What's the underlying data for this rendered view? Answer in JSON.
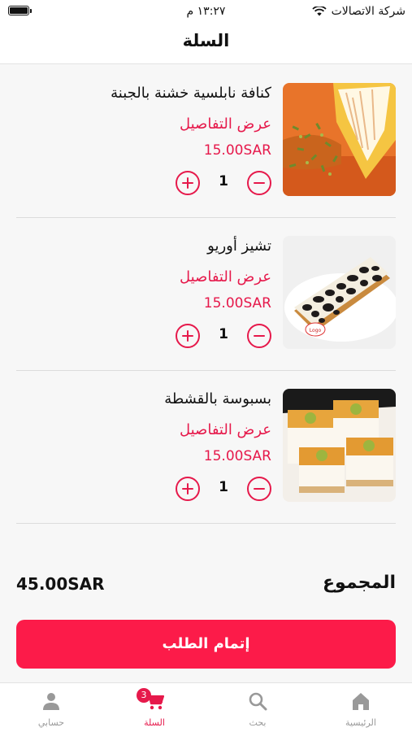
{
  "status_bar": {
    "carrier": "شركة الاتصالات",
    "time": "١٣:٢٧ م"
  },
  "header": {
    "title": "السلة"
  },
  "cart": {
    "items": [
      {
        "name": "كنافة نابلسية خشنة بالجبنة",
        "details_label": "عرض التفاصيل",
        "price": "15.00SAR",
        "quantity": "1",
        "image": "kunafa-photo"
      },
      {
        "name": "تشيز أوريو",
        "details_label": "عرض التفاصيل",
        "price": "15.00SAR",
        "quantity": "1",
        "image": "oreo-cheesecake-photo"
      },
      {
        "name": "بسبوسة بالقشطة",
        "details_label": "عرض التفاصيل",
        "price": "15.00SAR",
        "quantity": "1",
        "image": "basbousa-photo"
      }
    ]
  },
  "summary": {
    "total_label": "المجموع",
    "total_value": "45.00SAR"
  },
  "checkout": {
    "label": "إتمام الطلب"
  },
  "tabs": [
    {
      "label": "الرئيسية",
      "icon": "home-icon"
    },
    {
      "label": "بحث",
      "icon": "search-icon"
    },
    {
      "label": "السلة",
      "icon": "cart-icon",
      "badge": "3"
    },
    {
      "label": "حسابي",
      "icon": "user-icon"
    }
  ],
  "colors": {
    "accent": "#e6194b",
    "button": "#fc1b49",
    "tab_inactive": "#999999"
  }
}
